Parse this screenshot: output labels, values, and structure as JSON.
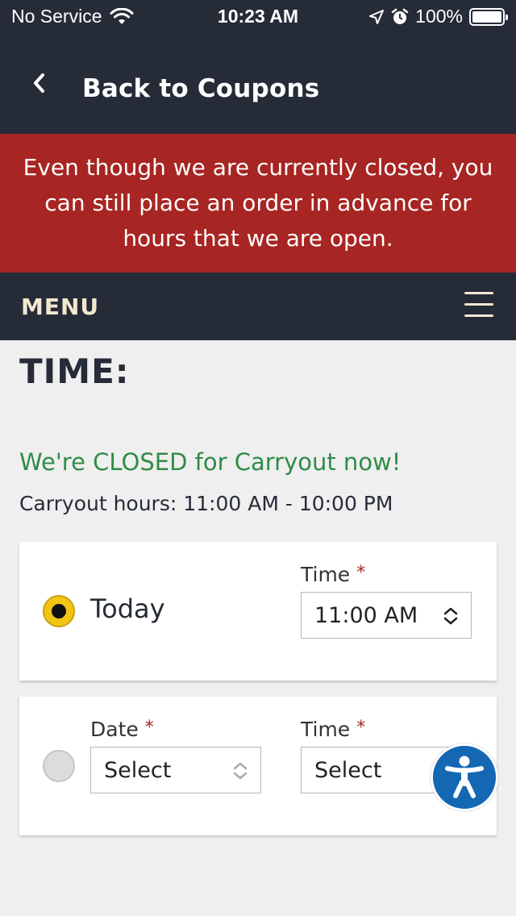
{
  "status": {
    "carrier": "No Service",
    "time": "10:23 AM",
    "battery": "100%"
  },
  "nav": {
    "back_label": "Back to Coupons"
  },
  "banner": {
    "text": "Even though we are currently closed, you can still place an order in advance for hours that we are open."
  },
  "menu": {
    "label": "MENU"
  },
  "content": {
    "heading": "TIME:",
    "closed_message": "We're CLOSED for Carryout now!",
    "hours_message": "Carryout hours: 11:00 AM - 10:00 PM"
  },
  "option_today": {
    "label": "Today",
    "time_label": "Time",
    "required_mark": "*",
    "time_value": "11:00 AM",
    "selected": true
  },
  "option_later": {
    "date_label": "Date",
    "date_value": "Select",
    "time_label": "Time",
    "time_value": "Select",
    "required_mark": "*",
    "selected": false
  },
  "colors": {
    "nav_bg": "#262b38",
    "banner_red": "#a72522",
    "closed_green": "#2f8c46",
    "radio_yellow": "#f2c515",
    "accessibility_blue": "#1467b3"
  }
}
